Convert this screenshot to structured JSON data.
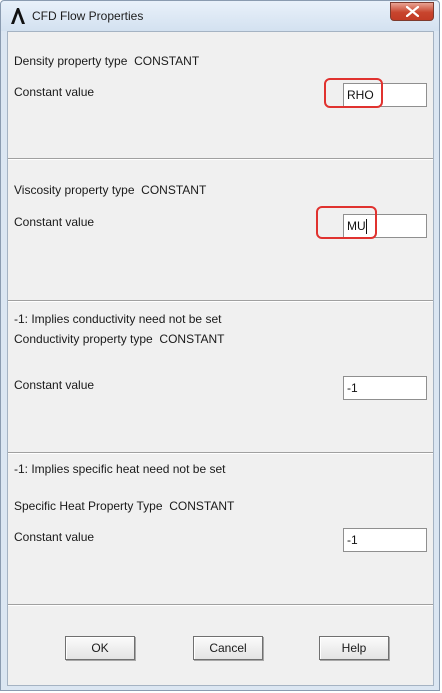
{
  "window": {
    "title": "CFD Flow Properties"
  },
  "sections": {
    "density": {
      "type_label": "Density property type",
      "type_value": "CONSTANT",
      "value_label": "Constant value",
      "value": "RHO"
    },
    "viscosity": {
      "type_label": "Viscosity property type",
      "type_value": "CONSTANT",
      "value_label": "Constant value",
      "value": "MU"
    },
    "conductivity": {
      "note": "-1: Implies conductivity need not be set",
      "type_label": "Conductivity property type",
      "type_value": "CONSTANT",
      "value_label": "Constant value",
      "value": "-1"
    },
    "specific_heat": {
      "note": "-1: Implies specific heat need not be set",
      "type_label": "Specific Heat Property Type",
      "type_value": "CONSTANT",
      "value_label": "Constant value",
      "value": "-1"
    }
  },
  "buttons": {
    "ok": "OK",
    "cancel": "Cancel",
    "help": "Help"
  },
  "colors": {
    "highlight_annotation": "#e0322f",
    "dialog_background": "#f0f0f0",
    "titlebar": "#dbe6f2",
    "close_button": "#c8452e"
  },
  "icons": {
    "app_icon": "ansys-logo-icon",
    "close": "close-icon"
  }
}
